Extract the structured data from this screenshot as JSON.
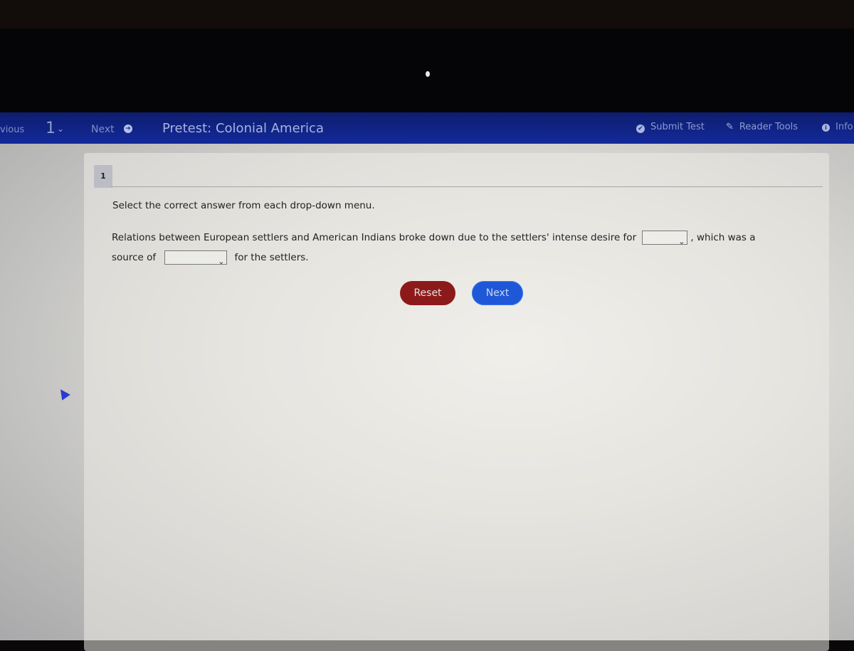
{
  "topbar": {
    "previous_label": "vious",
    "question_number": "1",
    "question_chevron": "⌄",
    "next_label": "Next",
    "next_icon": "➔",
    "title": "Pretest: Colonial America",
    "submit_label": "Submit Test",
    "submit_icon": "✔",
    "reader_tools_label": "Reader Tools",
    "reader_tools_icon": "✎",
    "info_label": "Info",
    "info_icon": "i"
  },
  "question": {
    "number": "1",
    "instruction": "Select the correct answer from each drop-down menu.",
    "text_part1": "Relations between European settlers and American Indians broke down due to the settlers' intense desire for",
    "dropdown1_value": "",
    "text_part2": ", which was a source of",
    "dropdown2_value": "",
    "text_part3": "for the settlers.",
    "chevron": "⌄"
  },
  "buttons": {
    "reset_label": "Reset",
    "next_label": "Next"
  }
}
